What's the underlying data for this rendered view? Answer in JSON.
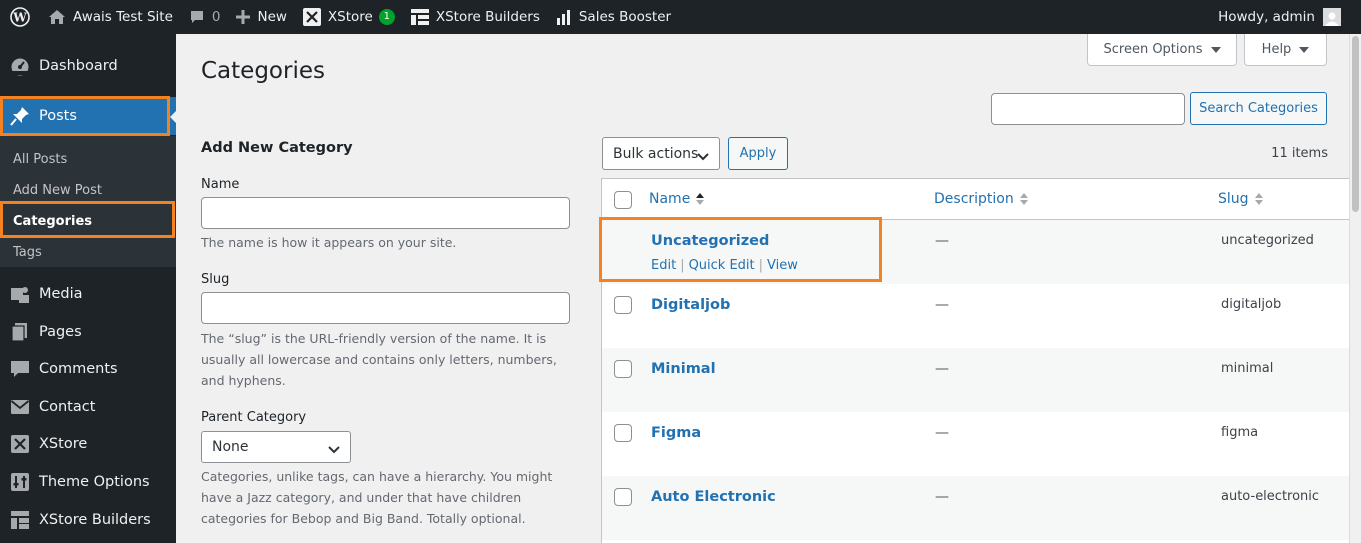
{
  "adminbar": {
    "site_name": "Awais Test Site",
    "comments_count": "0",
    "new_label": "New",
    "xstore_label": "XStore",
    "xstore_badge": "1",
    "xstore_builders_label": "XStore Builders",
    "sales_booster_label": "Sales Booster",
    "howdy": "Howdy, admin"
  },
  "sidebar": {
    "items": [
      {
        "label": "Dashboard",
        "icon": "dashboard-icon"
      },
      {
        "label": "Posts",
        "icon": "pin-icon"
      },
      {
        "label": "Media",
        "icon": "media-icon"
      },
      {
        "label": "Pages",
        "icon": "pages-icon"
      },
      {
        "label": "Comments",
        "icon": "comments-icon"
      },
      {
        "label": "Contact",
        "icon": "mail-icon"
      },
      {
        "label": "XStore",
        "icon": "xstore-icon"
      },
      {
        "label": "Theme Options",
        "icon": "sliders-icon"
      },
      {
        "label": "XStore Builders",
        "icon": "grid-icon"
      }
    ],
    "submenu": [
      "All Posts",
      "Add New Post",
      "Categories",
      "Tags"
    ]
  },
  "header": {
    "title": "Categories",
    "screen_options": "Screen Options",
    "help": "Help"
  },
  "search": {
    "button": "Search Categories",
    "value": ""
  },
  "form": {
    "heading": "Add New Category",
    "name_label": "Name",
    "name_help": "The name is how it appears on your site.",
    "slug_label": "Slug",
    "slug_help": "The “slug” is the URL-friendly version of the name. It is usually all lowercase and contains only letters, numbers, and hyphens.",
    "parent_label": "Parent Category",
    "parent_value": "None",
    "parent_help": "Categories, unlike tags, can have a hierarchy. You might have a Jazz category, and under that have children categories for Bebop and Big Band. Totally optional."
  },
  "list": {
    "bulk_actions": "Bulk actions",
    "apply": "Apply",
    "items_count": "11 items",
    "columns": [
      "Name",
      "Description",
      "Slug"
    ],
    "row_actions": [
      "Edit",
      "Quick Edit",
      "View"
    ],
    "row_action_separator": "|",
    "rows": [
      {
        "name": "Uncategorized",
        "description": "—",
        "slug": "uncategorized"
      },
      {
        "name": "Digitaljob",
        "description": "—",
        "slug": "digitaljob"
      },
      {
        "name": "Minimal",
        "description": "—",
        "slug": "minimal"
      },
      {
        "name": "Figma",
        "description": "—",
        "slug": "figma"
      },
      {
        "name": "Auto Electronic",
        "description": "—",
        "slug": "auto-electronic"
      }
    ]
  },
  "colors": {
    "adminbar_bg": "#1d2327",
    "accent": "#2271b1",
    "highlight_border": "#f58220"
  }
}
